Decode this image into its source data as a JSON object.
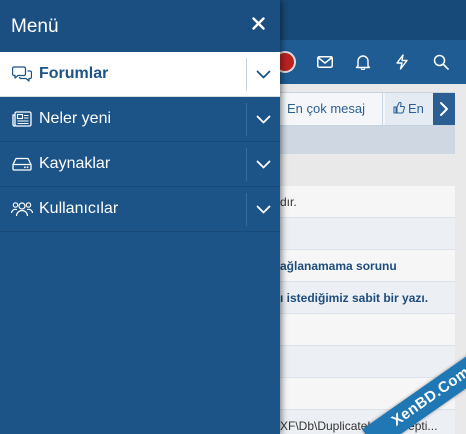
{
  "menu": {
    "title": "Menü",
    "items": [
      {
        "label": "Forumlar",
        "icon": "forum-chat-icon",
        "active": true
      },
      {
        "label": "Neler yeni",
        "icon": "newspaper-icon",
        "active": false
      },
      {
        "label": "Kaynaklar",
        "icon": "drive-icon",
        "active": false
      },
      {
        "label": "Kullanıcılar",
        "icon": "users-icon",
        "active": false
      }
    ]
  },
  "background": {
    "tabs": [
      "En çok mesaj",
      "En"
    ],
    "rows": [
      {
        "text": "dır.",
        "bold": false
      },
      {
        "text": "",
        "bold": false
      },
      {
        "text": "ağlanamama sorunu",
        "bold": true
      },
      {
        "text": "ı istediğimiz sabit bir yazı.",
        "bold": true
      },
      {
        "text": "",
        "bold": false
      },
      {
        "text": "",
        "bold": false
      },
      {
        "text": "",
        "bold": false
      },
      {
        "text": "XF\\Db\\DuplicateKeyExcepti...",
        "bold": false
      }
    ]
  },
  "watermark": {
    "text": "XenBD.Com"
  },
  "colors": {
    "drawer_bg": "#1d5487",
    "drawer_header": "#1b4f81",
    "active_item_bg": "#ffffff",
    "active_item_text": "#1d5487",
    "topbar": "#174a78",
    "watermark_bg": "#1f77b4"
  }
}
